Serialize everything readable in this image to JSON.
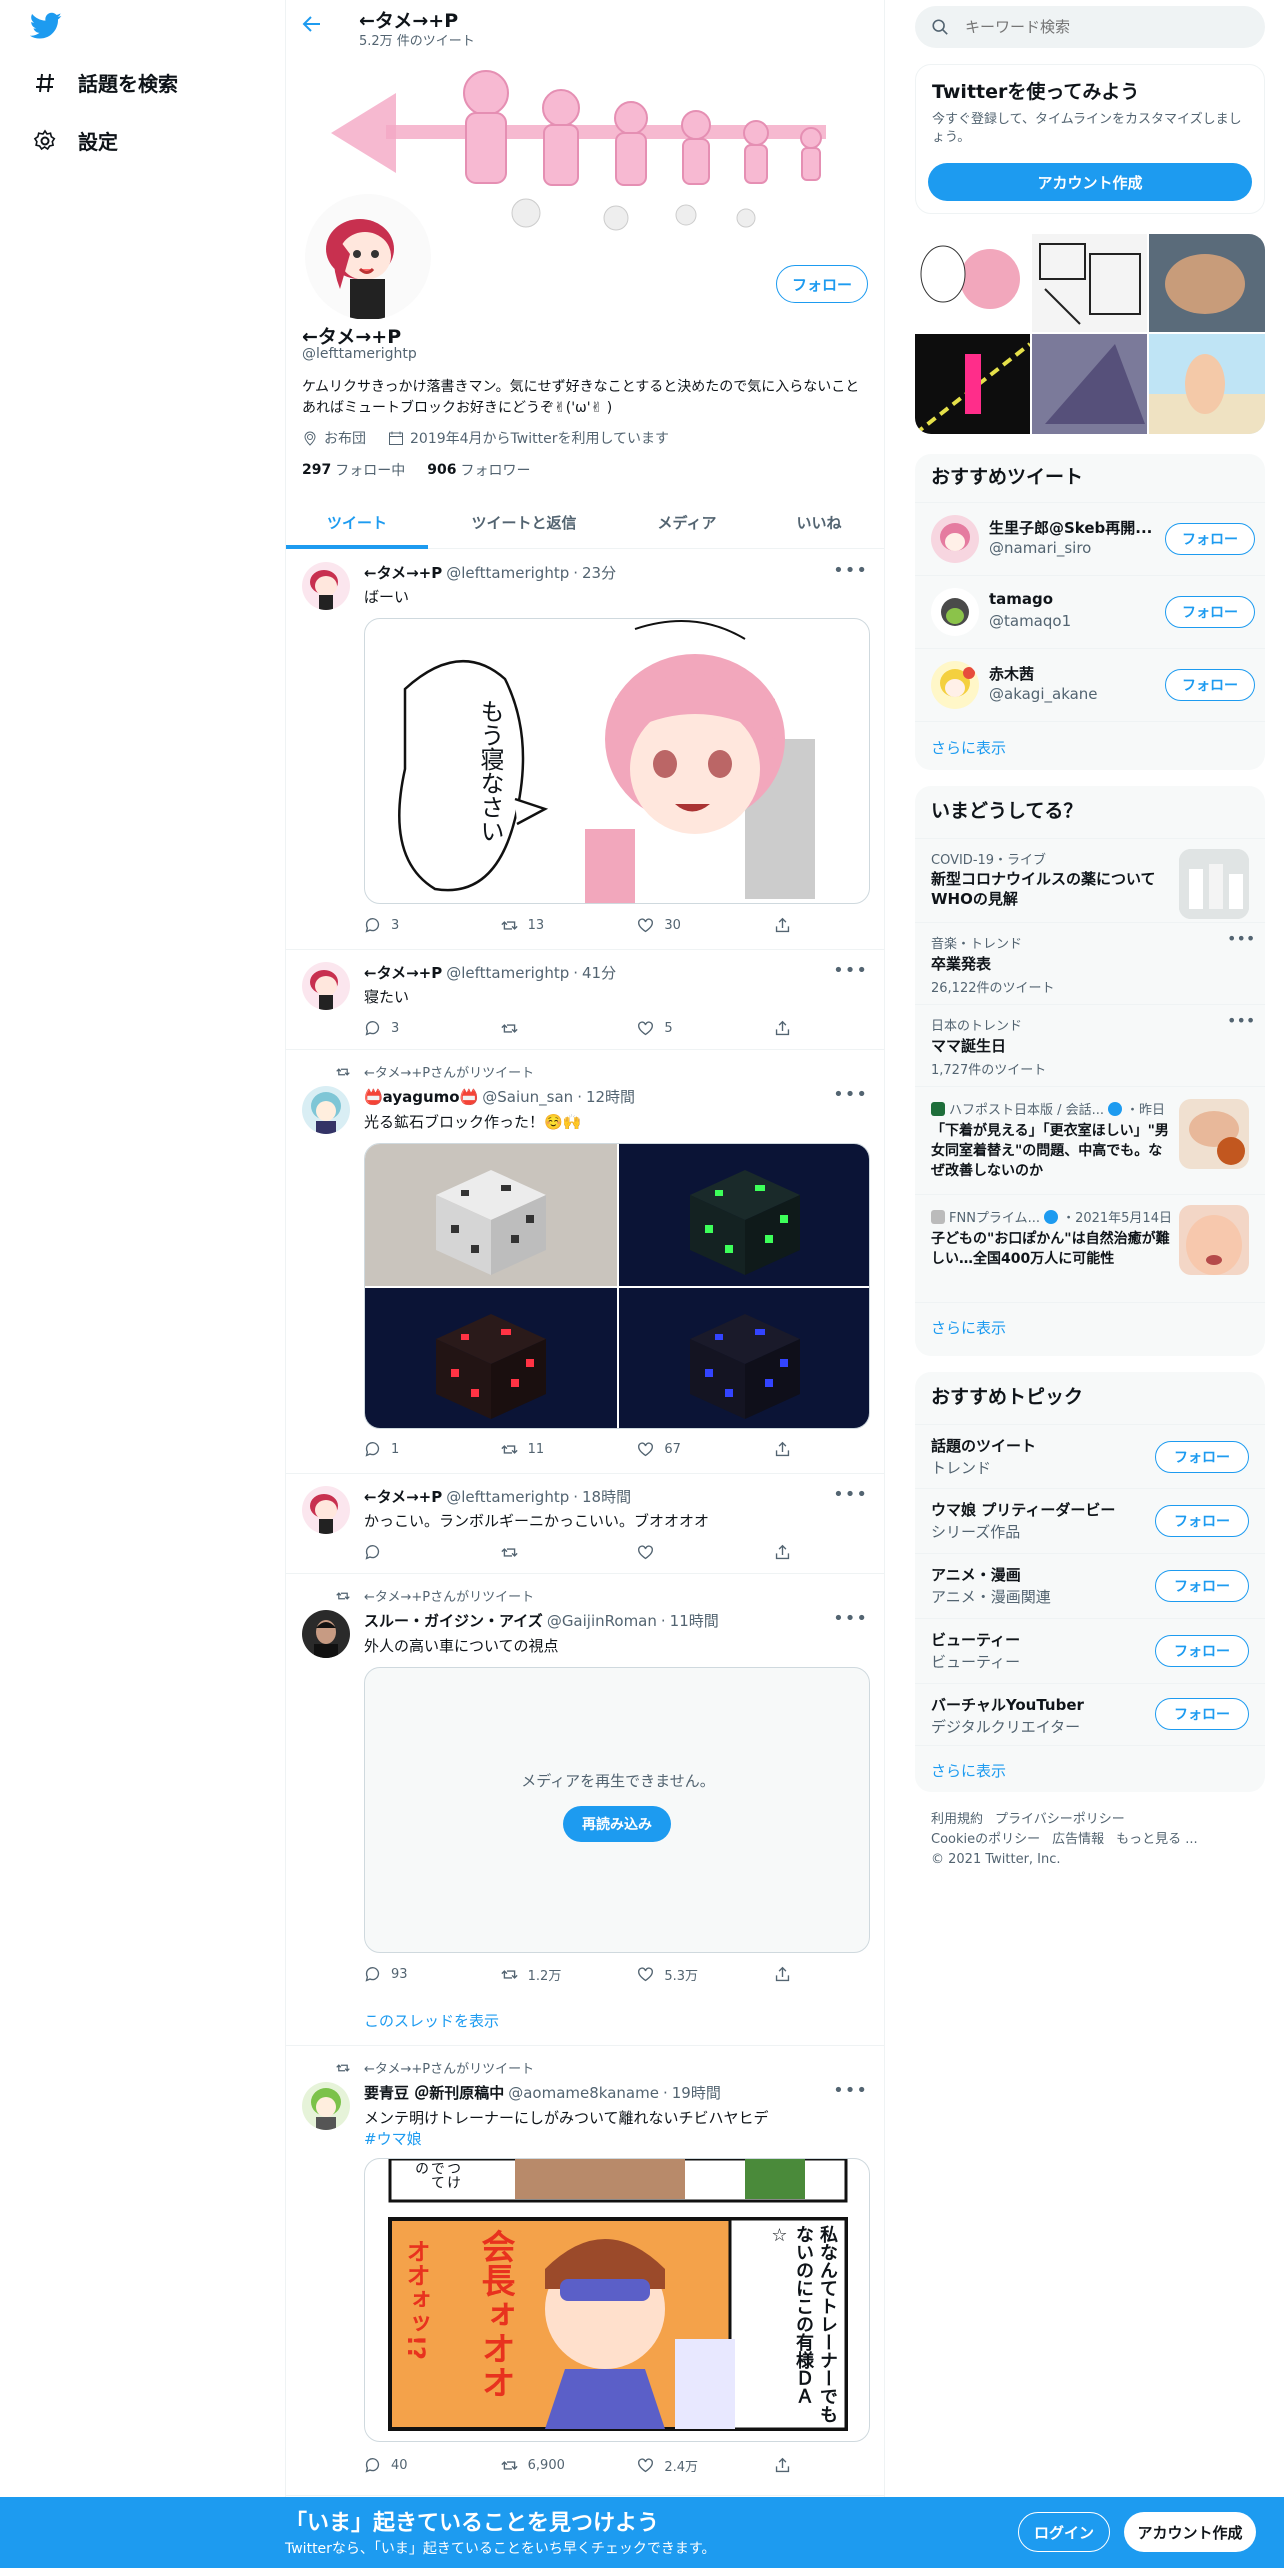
{
  "nav": {
    "explore": "話題を検索",
    "settings": "設定"
  },
  "header": {
    "name": "←タメ→+P",
    "tweet_count": "5.2万 件のツイート"
  },
  "profile": {
    "name": "←タメ→+P",
    "handle": "@lefttamerightp",
    "follow": "フォロー",
    "bio": "ケムリクサきっかけ落書きマン。気にせず好きなことすると決めたので気に入らないことあればミュートブロックお好きにどうぞ✌('ω'✌ )",
    "location": "お布団",
    "joined": "2019年4月からTwitterを利用しています",
    "following_count": "297",
    "following_label": "フォロー中",
    "followers_count": "906",
    "followers_label": "フォロワー"
  },
  "tabs": [
    "ツイート",
    "ツイートと返信",
    "メディア",
    "いいね"
  ],
  "tweets": [
    {
      "name": "←タメ→+P",
      "handle": "@lefttamerightp",
      "time": "23分",
      "text": "ばーい",
      "image_text": "もう寝なさい",
      "reply": "3",
      "retweet": "13",
      "like": "30"
    },
    {
      "name": "←タメ→+P",
      "handle": "@lefttamerightp",
      "time": "41分",
      "text": "寝たい",
      "reply": "3",
      "retweet": "",
      "like": "5"
    },
    {
      "rt_label": "←タメ→+Pさんがリツイート",
      "name": "📛ayagumo📛",
      "handle": "@Saiun_san",
      "time": "12時間",
      "text": "光る鉱石ブロック作った！☺️🙌",
      "reply": "1",
      "retweet": "11",
      "like": "67"
    },
    {
      "name": "←タメ→+P",
      "handle": "@lefttamerightp",
      "time": "18時間",
      "text": "かっこい。ランボルギーニかっこいい。ブオオオオ",
      "reply": "",
      "retweet": "",
      "like": ""
    },
    {
      "rt_label": "←タメ→+Pさんがリツイート",
      "name": "スルー・ガイジン・アイズ",
      "handle": "@GaijinRoman",
      "time": "11時間",
      "text": "外人の高い車についての視点",
      "media_error": "メディアを再生できません。",
      "reload": "再読み込み",
      "reply": "93",
      "retweet": "1.2万",
      "like": "5.3万",
      "thread": "このスレッドを表示"
    },
    {
      "rt_label": "←タメ→+Pさんがリツイート",
      "name": "要青豆 ＠新刊原稿中",
      "handle": "@aomame8kaname",
      "time": "19時間",
      "text": "メンテ明けトレーナーにしがみついて離れないチビハヤヒデ",
      "hashtag": "#ウマ娘",
      "manga_right": "私なんてトレーナーでもないのにこの有様ＤＡ☆",
      "manga_left": "会長ォオオ",
      "manga_left2": "オオォッ!?",
      "manga_top": "つけでての",
      "reply": "40",
      "retweet": "6,900",
      "like": "2.4万"
    }
  ],
  "search": {
    "placeholder": "キーワード検索"
  },
  "signup": {
    "title": "Twitterを使ってみよう",
    "desc": "今すぐ登録して、タイムラインをカスタマイズしましょう。",
    "button": "アカウント作成"
  },
  "recommended_tweets": {
    "title": "おすすめツイート",
    "users": [
      {
        "name": "生里子郎@Skeb再開...",
        "handle": "@namari_siro"
      },
      {
        "name": "tamago",
        "handle": "@tamaqo1"
      },
      {
        "name": "赤木茜",
        "handle": "@akagi_akane"
      }
    ],
    "more": "さらに表示"
  },
  "trends": {
    "title": "いまどうしてる？",
    "items": [
      {
        "meta": "COVID-19・ライブ",
        "title": "新型コロナウイルスの薬についてWHOの見解"
      },
      {
        "meta": "音楽・トレンド",
        "title": "卒業発表",
        "count": "26,122件のツイート"
      },
      {
        "meta": "日本のトレンド",
        "title": "ママ誕生日",
        "count": "1,727件のツイート"
      },
      {
        "meta": "ハフポスト日本版 / 会話...",
        "time": "・昨日",
        "title": "「下着が見える」「更衣室ほしい」\"男女同室着替え\"の問題、中高でも。なぜ改善しないのか"
      },
      {
        "meta": "FNNプライム...",
        "time": "・2021年5月14日",
        "title": "子どもの\"お口ぽかん\"は自然治癒が難しい…全国400万人に可能性"
      }
    ],
    "more": "さらに表示"
  },
  "topics": {
    "title": "おすすめトピック",
    "items": [
      {
        "name": "話題のツイート",
        "sub": "トレンド"
      },
      {
        "name": "ウマ娘 プリティーダービー",
        "sub": "シリーズ作品"
      },
      {
        "name": "アニメ・漫画",
        "sub": "アニメ・漫画関連"
      },
      {
        "name": "ビューティー",
        "sub": "ビューティー"
      },
      {
        "name": "バーチャルYouTuber",
        "sub": "デジタルクリエイター"
      }
    ],
    "more": "さらに表示"
  },
  "footer_links": {
    "line1a": "利用規約",
    "line1b": "プライバシーポリシー",
    "line2a": "Cookieのポリシー",
    "line2b": "広告情報",
    "line2c": "もっと見る ...",
    "copy": "© 2021 Twitter, Inc."
  },
  "bottom_bar": {
    "title": "「いま」起きていることを見つけよう",
    "sub": "Twitterなら、「いま」起きていることをいち早くチェックできます。",
    "login": "ログイン",
    "signup": "アカウント作成"
  },
  "colors": {
    "accent": "#1d9bf0",
    "text": "#0f1419",
    "muted": "#536471"
  }
}
